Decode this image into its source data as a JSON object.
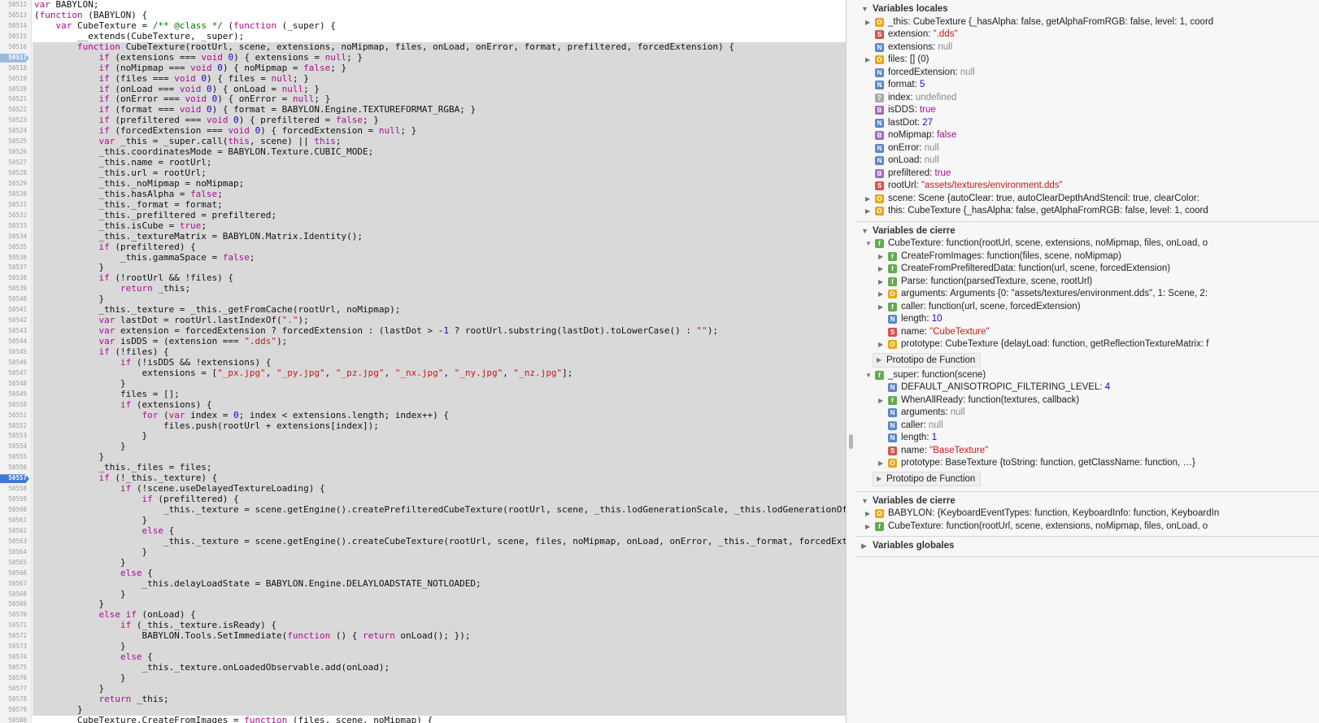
{
  "editor": {
    "lines": [
      {
        "n": "50512",
        "code": "var BABYLON;"
      },
      {
        "n": "50513",
        "code": "(function (BABYLON) {"
      },
      {
        "n": "50514",
        "code": "    var CubeTexture = /** @class */ (function (_super) {"
      },
      {
        "n": "50515",
        "code": "        __extends(CubeTexture, _super);"
      },
      {
        "n": "50516",
        "code": "        function CubeTexture(rootUrl, scene, extensions, noMipmap, files, onLoad, onError, format, prefiltered, forcedExtension) {"
      },
      {
        "n": "50517",
        "code": "            if (extensions === void 0) { extensions = null; }"
      },
      {
        "n": "50518",
        "code": "            if (noMipmap === void 0) { noMipmap = false; }"
      },
      {
        "n": "50519",
        "code": "            if (files === void 0) { files = null; }"
      },
      {
        "n": "50520",
        "code": "            if (onLoad === void 0) { onLoad = null; }"
      },
      {
        "n": "50521",
        "code": "            if (onError === void 0) { onError = null; }"
      },
      {
        "n": "50522",
        "code": "            if (format === void 0) { format = BABYLON.Engine.TEXTUREFORMAT_RGBA; }"
      },
      {
        "n": "50523",
        "code": "            if (prefiltered === void 0) { prefiltered = false; }"
      },
      {
        "n": "50524",
        "code": "            if (forcedExtension === void 0) { forcedExtension = null; }"
      },
      {
        "n": "50525",
        "code": "            var _this = _super.call(this, scene) || this;"
      },
      {
        "n": "50526",
        "code": "            _this.coordinatesMode = BABYLON.Texture.CUBIC_MODE;"
      },
      {
        "n": "50527",
        "code": "            _this.name = rootUrl;"
      },
      {
        "n": "50528",
        "code": "            _this.url = rootUrl;"
      },
      {
        "n": "50529",
        "code": "            _this._noMipmap = noMipmap;"
      },
      {
        "n": "50530",
        "code": "            _this.hasAlpha = false;"
      },
      {
        "n": "50531",
        "code": "            _this._format = format;"
      },
      {
        "n": "50532",
        "code": "            _this._prefiltered = prefiltered;"
      },
      {
        "n": "50533",
        "code": "            _this.isCube = true;"
      },
      {
        "n": "50534",
        "code": "            _this._textureMatrix = BABYLON.Matrix.Identity();"
      },
      {
        "n": "50535",
        "code": "            if (prefiltered) {"
      },
      {
        "n": "50536",
        "code": "                _this.gammaSpace = false;"
      },
      {
        "n": "50537",
        "code": "            }"
      },
      {
        "n": "50538",
        "code": "            if (!rootUrl && !files) {"
      },
      {
        "n": "50539",
        "code": "                return _this;"
      },
      {
        "n": "50540",
        "code": "            }"
      },
      {
        "n": "50541",
        "code": "            _this._texture = _this._getFromCache(rootUrl, noMipmap);"
      },
      {
        "n": "50542",
        "code": "            var lastDot = rootUrl.lastIndexOf(\".\");"
      },
      {
        "n": "50543",
        "code": "            var extension = forcedExtension ? forcedExtension : (lastDot > -1 ? rootUrl.substring(lastDot).toLowerCase() : \"\");"
      },
      {
        "n": "50544",
        "code": "            var isDDS = (extension === \".dds\");"
      },
      {
        "n": "50545",
        "code": "            if (!files) {"
      },
      {
        "n": "50546",
        "code": "                if (!isDDS && !extensions) {"
      },
      {
        "n": "50547",
        "code": "                    extensions = [\"_px.jpg\", \"_py.jpg\", \"_pz.jpg\", \"_nx.jpg\", \"_ny.jpg\", \"_nz.jpg\"];"
      },
      {
        "n": "50548",
        "code": "                }"
      },
      {
        "n": "50549",
        "code": "                files = [];"
      },
      {
        "n": "50550",
        "code": "                if (extensions) {"
      },
      {
        "n": "50551",
        "code": "                    for (var index = 0; index < extensions.length; index++) {"
      },
      {
        "n": "50552",
        "code": "                        files.push(rootUrl + extensions[index]);"
      },
      {
        "n": "50553",
        "code": "                    }"
      },
      {
        "n": "50554",
        "code": "                }"
      },
      {
        "n": "50555",
        "code": "            }"
      },
      {
        "n": "50556",
        "code": "            _this._files = files;"
      },
      {
        "n": "50557",
        "code": "            if (!_this._texture) {"
      },
      {
        "n": "50558",
        "code": "                if (!scene.useDelayedTextureLoading) {"
      },
      {
        "n": "50559",
        "code": "                    if (prefiltered) {"
      },
      {
        "n": "50560",
        "code": "                        _this._texture = scene.getEngine().createPrefilteredCubeTexture(rootUrl, scene, _this.lodGenerationScale, _this.lodGenerationOffset,"
      },
      {
        "n": "50561",
        "code": "                    }"
      },
      {
        "n": "50562",
        "code": "                    else {"
      },
      {
        "n": "50563",
        "code": "                        _this._texture = scene.getEngine().createCubeTexture(rootUrl, scene, files, noMipmap, onLoad, onError, _this._format, forcedExtensio"
      },
      {
        "n": "50564",
        "code": "                    }"
      },
      {
        "n": "50565",
        "code": "                }"
      },
      {
        "n": "50566",
        "code": "                else {"
      },
      {
        "n": "50567",
        "code": "                    _this.delayLoadState = BABYLON.Engine.DELAYLOADSTATE_NOTLOADED;"
      },
      {
        "n": "50568",
        "code": "                }"
      },
      {
        "n": "50569",
        "code": "            }"
      },
      {
        "n": "50570",
        "code": "            else if (onLoad) {"
      },
      {
        "n": "50571",
        "code": "                if (_this._texture.isReady) {"
      },
      {
        "n": "50572",
        "code": "                    BABYLON.Tools.SetImmediate(function () { return onLoad(); });"
      },
      {
        "n": "50573",
        "code": "                }"
      },
      {
        "n": "50574",
        "code": "                else {"
      },
      {
        "n": "50575",
        "code": "                    _this._texture.onLoadedObservable.add(onLoad);"
      },
      {
        "n": "50576",
        "code": "                }"
      },
      {
        "n": "50577",
        "code": "            }"
      },
      {
        "n": "50578",
        "code": "            return _this;"
      },
      {
        "n": "50579",
        "code": "        }"
      },
      {
        "n": "50580",
        "code": "        CubeTexture.CreateFromImages = function (files, scene, noMipmap) {"
      }
    ]
  },
  "variables": {
    "local": {
      "title": "Variables locales",
      "items": [
        {
          "badge": "O",
          "key": "_this",
          "value": "CubeTexture {_hasAlpha: false, getAlphaFromRGB: false, level: 1, coord",
          "vt": "p",
          "exp": true
        },
        {
          "badge": "S",
          "key": "extension",
          "value": "\".dds\"",
          "vt": "s",
          "exp": false
        },
        {
          "badge": "N",
          "key": "extensions",
          "value": "null",
          "vt": "g",
          "exp": false,
          "gray": true
        },
        {
          "badge": "O",
          "key": "files",
          "value": "[] (0)",
          "vt": "p",
          "exp": true
        },
        {
          "badge": "N",
          "key": "forcedExtension",
          "value": "null",
          "vt": "g",
          "exp": false,
          "gray": true
        },
        {
          "badge": "N",
          "key": "format",
          "value": "5",
          "vt": "n",
          "exp": false
        },
        {
          "badge": "?",
          "key": "index",
          "value": "undefined",
          "vt": "g",
          "exp": false,
          "gray": true
        },
        {
          "badge": "B",
          "key": "isDDS",
          "value": "true",
          "vt": "k",
          "exp": false
        },
        {
          "badge": "N",
          "key": "lastDot",
          "value": "27",
          "vt": "n",
          "exp": false
        },
        {
          "badge": "B",
          "key": "noMipmap",
          "value": "false",
          "vt": "k",
          "exp": false
        },
        {
          "badge": "N",
          "key": "onError",
          "value": "null",
          "vt": "g",
          "exp": false,
          "gray": true
        },
        {
          "badge": "N",
          "key": "onLoad",
          "value": "null",
          "vt": "g",
          "exp": false,
          "gray": true
        },
        {
          "badge": "B",
          "key": "prefiltered",
          "value": "true",
          "vt": "k",
          "exp": false
        },
        {
          "badge": "S",
          "key": "rootUrl",
          "value": "\"assets/textures/environment.dds\"",
          "vt": "s",
          "exp": false
        },
        {
          "badge": "O",
          "key": "scene",
          "value": "Scene {autoClear: true, autoClearDepthAndStencil: true, clearColor: ",
          "vt": "p",
          "exp": true
        },
        {
          "badge": "O",
          "key": "this",
          "value": "CubeTexture {_hasAlpha: false, getAlphaFromRGB: false, level: 1, coord",
          "vt": "p",
          "exp": true
        }
      ]
    },
    "closure1": {
      "title": "Variables de cierre",
      "items": [
        {
          "badge": "f",
          "key": "CubeTexture",
          "value": "function(rootUrl, scene, extensions, noMipmap, files, onLoad, o",
          "vt": "p",
          "exp": "open",
          "lvl": 0
        },
        {
          "badge": "f",
          "key": "CreateFromImages",
          "value": "function(files, scene, noMipmap)",
          "vt": "p",
          "exp": true,
          "lvl": 1
        },
        {
          "badge": "f",
          "key": "CreateFromPrefilteredData",
          "value": "function(url, scene, forcedExtension)",
          "vt": "p",
          "exp": true,
          "lvl": 1
        },
        {
          "badge": "f",
          "key": "Parse",
          "value": "function(parsedTexture, scene, rootUrl)",
          "vt": "p",
          "exp": true,
          "lvl": 1
        },
        {
          "badge": "O",
          "key": "arguments",
          "value": "Arguments {0: \"assets/textures/environment.dds\", 1: Scene, 2: ",
          "vt": "p",
          "exp": true,
          "lvl": 1
        },
        {
          "badge": "f",
          "key": "caller",
          "value": "function(url, scene, forcedExtension)",
          "vt": "p",
          "exp": true,
          "lvl": 1
        },
        {
          "badge": "N",
          "key": "length",
          "value": "10",
          "vt": "n",
          "exp": false,
          "lvl": 1
        },
        {
          "badge": "S",
          "key": "name",
          "value": "\"CubeTexture\"",
          "vt": "s",
          "exp": false,
          "lvl": 1
        },
        {
          "badge": "O",
          "key": "prototype",
          "value": "CubeTexture {delayLoad: function, getReflectionTextureMatrix: f",
          "vt": "p",
          "exp": true,
          "lvl": 1
        },
        {
          "proto": "Prototipo de Function"
        },
        {
          "badge": "f",
          "key": "_super",
          "value": "function(scene)",
          "vt": "p",
          "exp": "open",
          "lvl": 0
        },
        {
          "badge": "N",
          "key": "DEFAULT_ANISOTROPIC_FILTERING_LEVEL",
          "value": "4",
          "vt": "n",
          "exp": false,
          "lvl": 1
        },
        {
          "badge": "f",
          "key": "WhenAllReady",
          "value": "function(textures, callback)",
          "vt": "p",
          "exp": true,
          "lvl": 1
        },
        {
          "badge": "N",
          "key": "arguments",
          "value": "null",
          "vt": "g",
          "exp": false,
          "lvl": 1,
          "gray": true
        },
        {
          "badge": "N",
          "key": "caller",
          "value": "null",
          "vt": "g",
          "exp": false,
          "lvl": 1,
          "gray": true
        },
        {
          "badge": "N",
          "key": "length",
          "value": "1",
          "vt": "n",
          "exp": false,
          "lvl": 1
        },
        {
          "badge": "S",
          "key": "name",
          "value": "\"BaseTexture\"",
          "vt": "s",
          "exp": false,
          "lvl": 1
        },
        {
          "badge": "O",
          "key": "prototype",
          "value": "BaseTexture {toString: function, getClassName: function, …}",
          "vt": "p",
          "exp": true,
          "lvl": 1
        },
        {
          "proto": "Prototipo de Function"
        }
      ]
    },
    "closure2": {
      "title": "Variables de cierre",
      "items": [
        {
          "badge": "O",
          "key": "BABYLON",
          "value": "{KeyboardEventTypes: function, KeyboardInfo: function, KeyboardIn",
          "vt": "p",
          "exp": true
        },
        {
          "badge": "f",
          "key": "CubeTexture",
          "value": "function(rootUrl, scene, extensions, noMipmap, files, onLoad, o",
          "vt": "p",
          "exp": true
        }
      ]
    },
    "global": {
      "title": "Variables globales"
    }
  },
  "colors": {
    "keyword": "#aa0d91",
    "string": "#c41a16",
    "number": "#1c00cf",
    "comment": "#007400",
    "selection": "#d9d9d9",
    "breakpoint": "#3e7bd0"
  }
}
